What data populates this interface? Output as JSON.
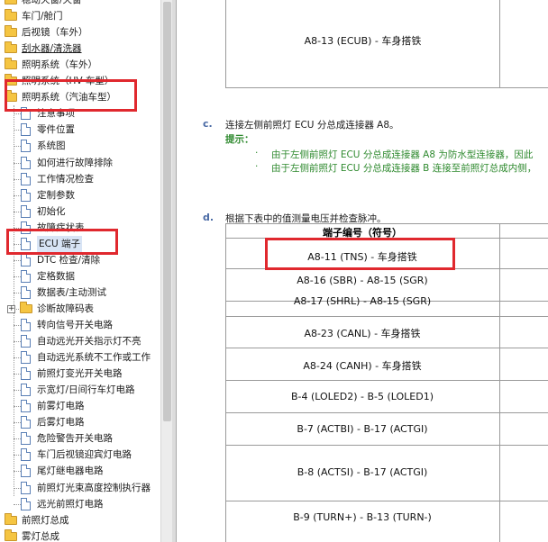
{
  "tree": {
    "items": [
      {
        "label": "稳动天窗/天窗",
        "type": "folder",
        "indent": 0,
        "underline": false
      },
      {
        "label": "车门/舱门",
        "type": "folder",
        "indent": 0,
        "underline": false
      },
      {
        "label": "后视镜（车外）",
        "type": "folder",
        "indent": 0,
        "underline": false
      },
      {
        "label": "刮水器/清洗器",
        "type": "folder",
        "indent": 0,
        "underline": true
      },
      {
        "label": "照明系统（车外）",
        "type": "folder",
        "indent": 0,
        "underline": false
      },
      {
        "label": "照明系统（HV 车型）",
        "type": "folder",
        "indent": 1,
        "underline": false
      },
      {
        "label": "照明系统（汽油车型）",
        "type": "folder-open",
        "indent": 1,
        "underline": false
      },
      {
        "label": "注意事项",
        "type": "doc",
        "indent": 2,
        "underline": false
      },
      {
        "label": "零件位置",
        "type": "doc",
        "indent": 2,
        "underline": false
      },
      {
        "label": "系统图",
        "type": "doc",
        "indent": 2,
        "underline": false
      },
      {
        "label": "如何进行故障排除",
        "type": "doc",
        "indent": 2,
        "underline": false
      },
      {
        "label": "工作情况检查",
        "type": "doc",
        "indent": 2,
        "underline": false
      },
      {
        "label": "定制参数",
        "type": "doc",
        "indent": 2,
        "underline": false
      },
      {
        "label": "初始化",
        "type": "doc",
        "indent": 2,
        "underline": false
      },
      {
        "label": "故障症状表",
        "type": "doc",
        "indent": 2,
        "underline": false
      },
      {
        "label": "ECU 端子",
        "type": "doc",
        "indent": 2,
        "underline": false,
        "selected": true
      },
      {
        "label": "DTC 检查/清除",
        "type": "doc",
        "indent": 2,
        "underline": false
      },
      {
        "label": "定格数据",
        "type": "doc",
        "indent": 2,
        "underline": false
      },
      {
        "label": "数据表/主动测试",
        "type": "doc",
        "indent": 2,
        "underline": false
      },
      {
        "label": "诊断故障码表",
        "type": "folder",
        "indent": 2,
        "underline": false,
        "expander": "+"
      },
      {
        "label": "转向信号开关电路",
        "type": "doc",
        "indent": 2,
        "underline": false
      },
      {
        "label": "自动远光开关指示灯不亮",
        "type": "doc",
        "indent": 2,
        "underline": false
      },
      {
        "label": "自动远光系统不工作或工作",
        "type": "doc",
        "indent": 2,
        "underline": false
      },
      {
        "label": "前照灯变光开关电路",
        "type": "doc",
        "indent": 2,
        "underline": false
      },
      {
        "label": "示宽灯/日间行车灯电路",
        "type": "doc",
        "indent": 2,
        "underline": false
      },
      {
        "label": "前雾灯电路",
        "type": "doc",
        "indent": 2,
        "underline": false
      },
      {
        "label": "后雾灯电路",
        "type": "doc",
        "indent": 2,
        "underline": false
      },
      {
        "label": "危险警告开关电路",
        "type": "doc",
        "indent": 2,
        "underline": false
      },
      {
        "label": "车门后视镜迎宾灯电路",
        "type": "doc",
        "indent": 2,
        "underline": false
      },
      {
        "label": "尾灯继电器电路",
        "type": "doc",
        "indent": 2,
        "underline": false
      },
      {
        "label": "前照灯光束高度控制执行器",
        "type": "doc",
        "indent": 2,
        "underline": false
      },
      {
        "label": "远光前照灯电路",
        "type": "doc",
        "indent": 2,
        "underline": false
      },
      {
        "label": "前照灯总成",
        "type": "folder",
        "indent": 0,
        "underline": false
      },
      {
        "label": "雾灯总成",
        "type": "folder",
        "indent": 0,
        "underline": false
      }
    ]
  },
  "content": {
    "top_row_label": "A8-13 (ECUB) - 车身搭铁",
    "step_c": {
      "letter": "c.",
      "text": "连接左侧前照灯 ECU 分总成连接器 A8。",
      "hint_title": "提示：",
      "hints": [
        "由于左侧前照灯 ECU 分总成连接器 A8 为防水型连接器，因此",
        "由于左侧前照灯 ECU 分总成连接器 B 连接至前照灯总成内侧，"
      ],
      "bullet": "·"
    },
    "step_d": {
      "letter": "d.",
      "text": "根据下表中的值测量电压并检查脉冲。"
    },
    "table": {
      "header": "端子编号（符号）",
      "rows": [
        "A8-11 (TNS) - 车身搭铁",
        "A8-16 (SBR) - A8-15 (SGR)",
        "A8-17 (SHRL) - A8-15 (SGR)",
        "A8-23 (CANL) - 车身搭铁",
        "A8-24 (CANH) - 车身搭铁",
        "B-4 (LOLED2) - B-5 (LOLED1)",
        "B-7 (ACTBI) - B-17 (ACTGI)",
        "B-8 (ACTSI) - B-17 (ACTGI)",
        "B-9 (TURN+) - B-13 (TURN-)"
      ]
    }
  },
  "colors": {
    "highlight": "#e0282e",
    "step_letter": "#4a6aa5",
    "hint": "#2f8a2f",
    "folder": "#f5c542",
    "doc_border": "#5a7fb5"
  }
}
